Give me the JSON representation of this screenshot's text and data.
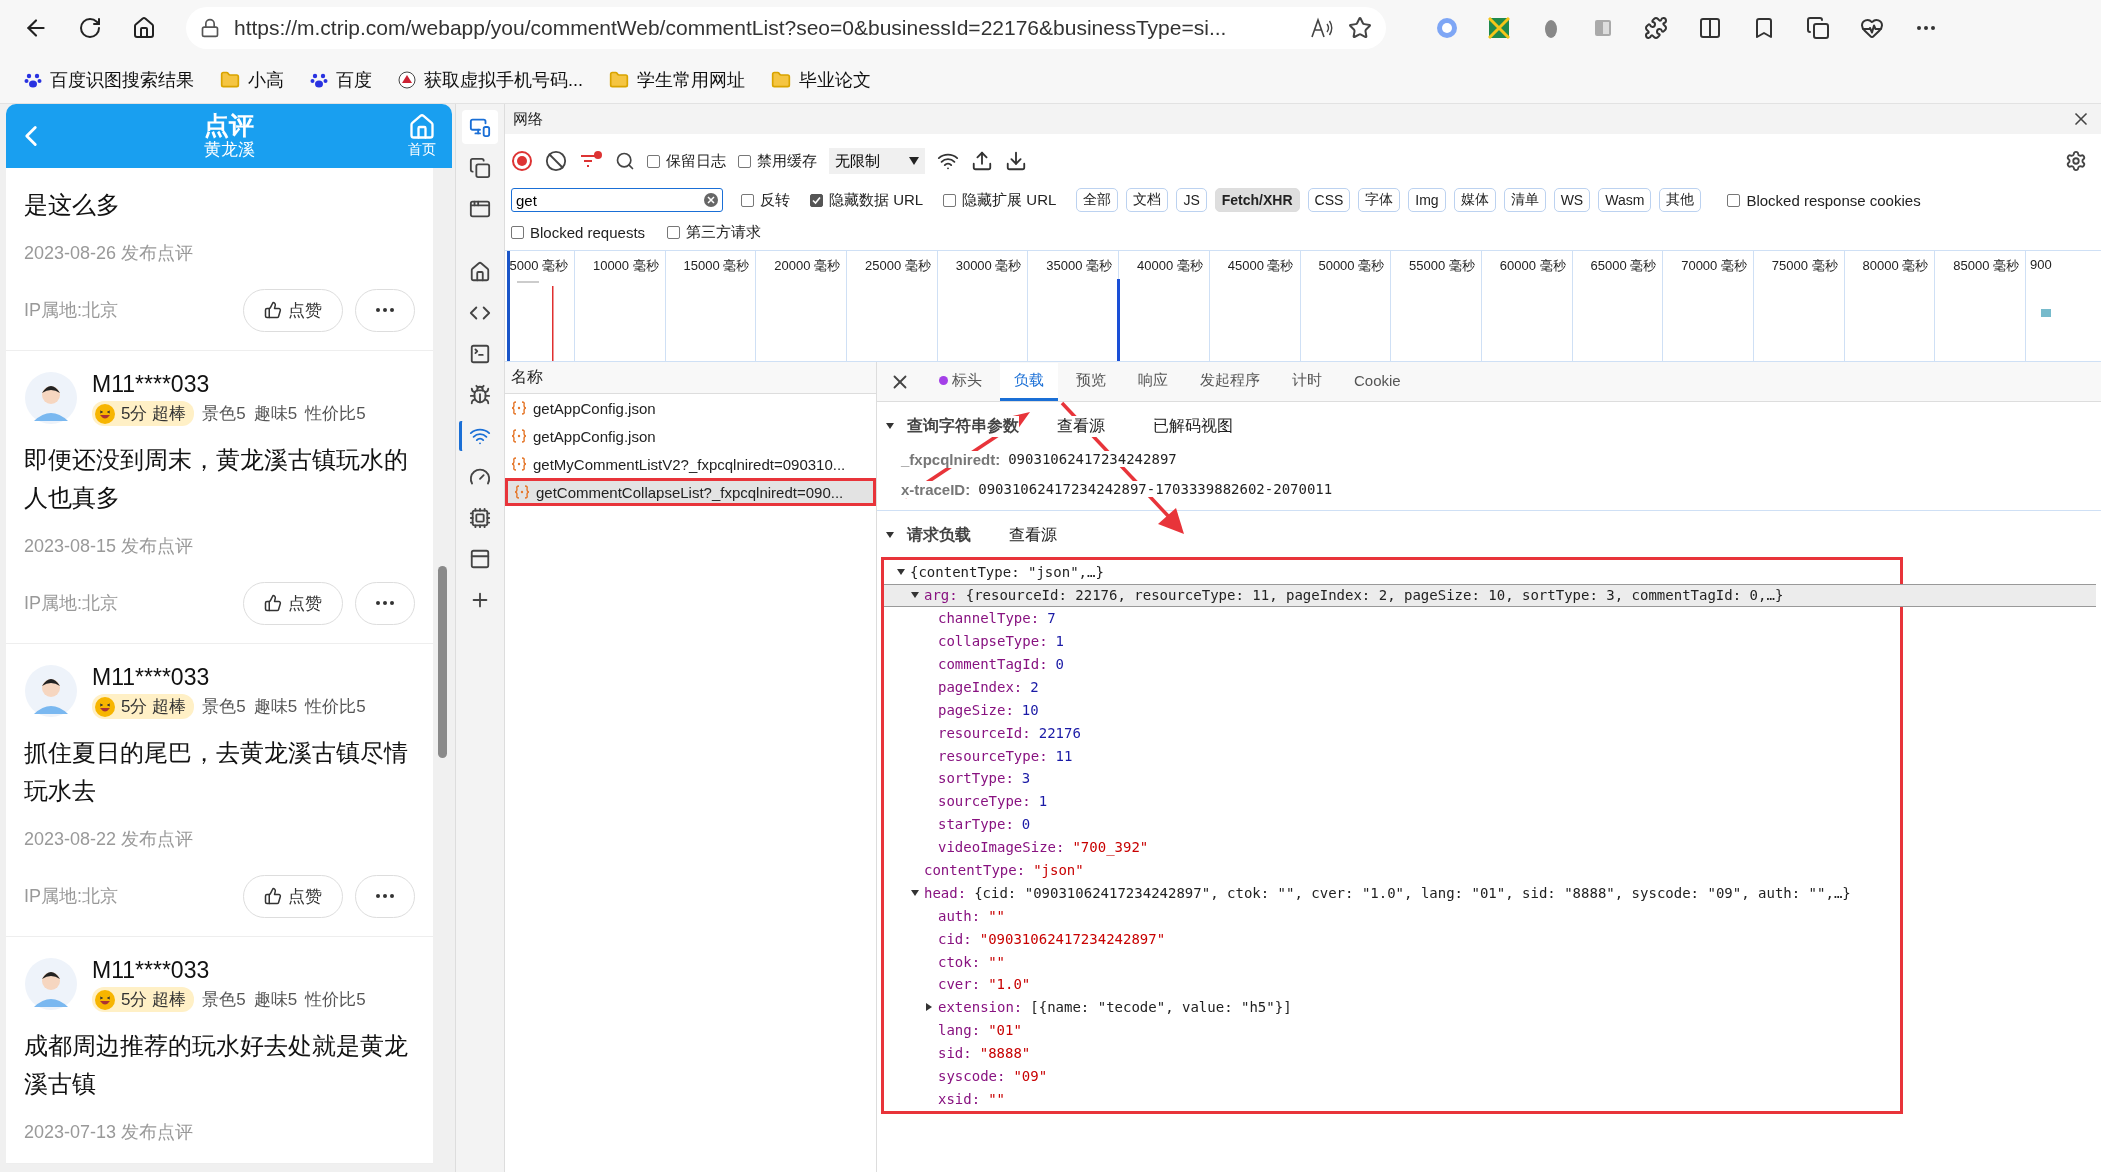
{
  "browser": {
    "url": "https://m.ctrip.com/webapp/you/commentWeb/commentList?seo=0&businessId=22176&businessType=si...",
    "bookmarks": [
      {
        "label": "百度识图搜索结果",
        "kind": "paw"
      },
      {
        "label": "小高",
        "kind": "folder"
      },
      {
        "label": "百度",
        "kind": "paw"
      },
      {
        "label": "获取虚拟手机号码...",
        "kind": "site"
      },
      {
        "label": "学生常用网址",
        "kind": "folder"
      },
      {
        "label": "毕业论文",
        "kind": "folder"
      }
    ]
  },
  "mobile": {
    "header": {
      "title": "点评",
      "subtitle": "黄龙溪",
      "home_label": "首页"
    },
    "reviews": [
      {
        "text": "是这么多",
        "date": "2023-08-26 发布点评",
        "ip": "IP属地:北京",
        "like": "点赞"
      },
      {
        "user": "M11****033",
        "score": "5分",
        "badge": "超棒",
        "ratings": [
          "景色5",
          "趣味5",
          "性价比5"
        ],
        "text": "即便还没到周末，黄龙溪古镇玩水的人也真多",
        "date": "2023-08-15 发布点评",
        "ip": "IP属地:北京",
        "like": "点赞"
      },
      {
        "user": "M11****033",
        "score": "5分",
        "badge": "超棒",
        "ratings": [
          "景色5",
          "趣味5",
          "性价比5"
        ],
        "text": "抓住夏日的尾巴，去黄龙溪古镇尽情玩水去",
        "date": "2023-08-22 发布点评",
        "ip": "IP属地:北京",
        "like": "点赞"
      },
      {
        "user": "M11****033",
        "score": "5分",
        "badge": "超棒",
        "ratings": [
          "景色5",
          "趣味5",
          "性价比5"
        ],
        "text": "成都周边推荐的玩水好去处就是黄龙溪古镇",
        "date": "2023-07-13 发布点评"
      }
    ]
  },
  "devtools": {
    "activity_bar": [
      {
        "kind": "device",
        "selected": true
      },
      {
        "kind": "copy",
        "selected": false
      },
      {
        "kind": "window",
        "selected": false
      },
      {
        "kind": "home",
        "selected": false
      },
      {
        "kind": "code",
        "selected": false
      },
      {
        "kind": "console",
        "selected": false
      },
      {
        "kind": "bug",
        "selected": false
      },
      {
        "kind": "wifi",
        "selected": true
      },
      {
        "kind": "gauge",
        "selected": false
      },
      {
        "kind": "cpu",
        "selected": false
      },
      {
        "kind": "app",
        "selected": false
      },
      {
        "kind": "plus",
        "selected": false
      }
    ],
    "panel_title": "网络",
    "toolbar": {
      "checkboxes": [
        {
          "label": "保留日志",
          "checked": false
        },
        {
          "label": "禁用缓存",
          "checked": false
        }
      ],
      "throttle": "无限制"
    },
    "filter": {
      "search": "get",
      "options": [
        {
          "label": "反转",
          "checked": false
        },
        {
          "label": "隐藏数据 URL",
          "checked": true
        },
        {
          "label": "隐藏扩展 URL",
          "checked": false
        }
      ],
      "types": [
        {
          "label": "全部",
          "selected": false
        },
        {
          "label": "文档",
          "selected": false
        },
        {
          "label": "JS",
          "selected": false
        },
        {
          "label": "Fetch/XHR",
          "selected": true
        },
        {
          "label": "CSS",
          "selected": false
        },
        {
          "label": "字体",
          "selected": false
        },
        {
          "label": "Img",
          "selected": false
        },
        {
          "label": "媒体",
          "selected": false
        },
        {
          "label": "清单",
          "selected": false
        },
        {
          "label": "WS",
          "selected": false
        },
        {
          "label": "Wasm",
          "selected": false
        },
        {
          "label": "其他",
          "selected": false
        }
      ],
      "blocked_cookies": {
        "label": "Blocked response cookies",
        "checked": false
      },
      "row2": [
        {
          "label": "Blocked requests",
          "checked": false
        },
        {
          "label": "第三方请求",
          "checked": false
        }
      ]
    },
    "timeline_ticks": [
      "5000 毫秒",
      "10000 毫秒",
      "15000 毫秒",
      "20000 毫秒",
      "25000 毫秒",
      "30000 毫秒",
      "35000 毫秒",
      "40000 毫秒",
      "45000 毫秒",
      "50000 毫秒",
      "55000 毫秒",
      "60000 毫秒",
      "65000 毫秒",
      "70000 毫秒",
      "75000 毫秒",
      "80000 毫秒",
      "85000 毫秒",
      "900"
    ],
    "requests": {
      "header": "名称",
      "rows": [
        {
          "name": "getAppConfig.json",
          "selected": false,
          "outlined": false
        },
        {
          "name": "getAppConfig.json",
          "selected": false,
          "outlined": false
        },
        {
          "name": "getMyCommentListV2?_fxpcqlniredt=090310...",
          "selected": false,
          "outlined": false
        },
        {
          "name": "getCommentCollapseList?_fxpcqlniredt=090...",
          "selected": true,
          "outlined": true
        }
      ]
    },
    "detail_tabs": [
      {
        "label": "标头",
        "dot": true,
        "selected": false
      },
      {
        "label": "负载",
        "dot": false,
        "selected": true
      },
      {
        "label": "预览",
        "dot": false,
        "selected": false
      },
      {
        "label": "响应",
        "dot": false,
        "selected": false
      },
      {
        "label": "发起程序",
        "dot": false,
        "selected": false
      },
      {
        "label": "计时",
        "dot": false,
        "selected": false
      },
      {
        "label": "Cookie",
        "dot": false,
        "selected": false
      }
    ],
    "query": {
      "title": "查询字符串参数",
      "links": [
        "查看源",
        "已解码视图"
      ],
      "params": [
        {
          "key": "_fxpcqlniredt:",
          "value": "09031062417234242897"
        },
        {
          "key": "x-traceID:",
          "value": "09031062417234242897-1703339882602-2070011"
        }
      ]
    },
    "payload": {
      "title": "请求负载",
      "link": "查看源",
      "outlined": true,
      "tree": {
        "kind": "object",
        "value": "{contentType: \"json\",…}",
        "expanded": true,
        "selected": false,
        "children": [
          {
            "key": "arg:",
            "kind": "object",
            "value": "{resourceId: 22176, resourceType: 11, pageIndex: 2, pageSize: 10, sortType: 3, commentTagId: 0,…}",
            "expanded": true,
            "selected": true,
            "children": [
              {
                "key": "channelType:",
                "kind": "number",
                "value": "7",
                "selected": false
              },
              {
                "key": "collapseType:",
                "kind": "number",
                "value": "1",
                "selected": false
              },
              {
                "key": "commentTagId:",
                "kind": "number",
                "value": "0",
                "selected": false
              },
              {
                "key": "pageIndex:",
                "kind": "number",
                "value": "2",
                "selected": false
              },
              {
                "key": "pageSize:",
                "kind": "number",
                "value": "10",
                "selected": false
              },
              {
                "key": "resourceId:",
                "kind": "number",
                "value": "22176",
                "selected": false
              },
              {
                "key": "resourceType:",
                "kind": "number",
                "value": "11",
                "selected": false
              },
              {
                "key": "sortType:",
                "kind": "number",
                "value": "3",
                "selected": false
              },
              {
                "key": "sourceType:",
                "kind": "number",
                "value": "1",
                "selected": false
              },
              {
                "key": "starType:",
                "kind": "number",
                "value": "0",
                "selected": false
              },
              {
                "key": "videoImageSize:",
                "kind": "string",
                "value": "\"700_392\"",
                "selected": false
              }
            ]
          },
          {
            "key": "contentType:",
            "kind": "string",
            "value": "\"json\"",
            "selected": false
          },
          {
            "key": "head:",
            "kind": "object",
            "value": "{cid: \"09031062417234242897\", ctok: \"\", cver: \"1.0\", lang: \"01\", sid: \"8888\", syscode: \"09\", auth: \"\",…}",
            "expanded": true,
            "selected": false,
            "children": [
              {
                "key": "auth:",
                "kind": "string",
                "value": "\"\"",
                "selected": false
              },
              {
                "key": "cid:",
                "kind": "string",
                "value": "\"09031062417234242897\"",
                "selected": false
              },
              {
                "key": "ctok:",
                "kind": "string",
                "value": "\"\"",
                "selected": false
              },
              {
                "key": "cver:",
                "kind": "string",
                "value": "\"1.0\"",
                "selected": false
              },
              {
                "key": "extension:",
                "kind": "object",
                "value": "[{name: \"tecode\", value: \"h5\"}]",
                "expanded": false,
                "selected": false
              },
              {
                "key": "lang:",
                "kind": "string",
                "value": "\"01\"",
                "selected": false
              },
              {
                "key": "sid:",
                "kind": "string",
                "value": "\"8888\"",
                "selected": false
              },
              {
                "key": "syscode:",
                "kind": "string",
                "value": "\"09\"",
                "selected": false
              },
              {
                "key": "xsid:",
                "kind": "string",
                "value": "\"\"",
                "selected": false
              }
            ]
          }
        ]
      }
    }
  }
}
